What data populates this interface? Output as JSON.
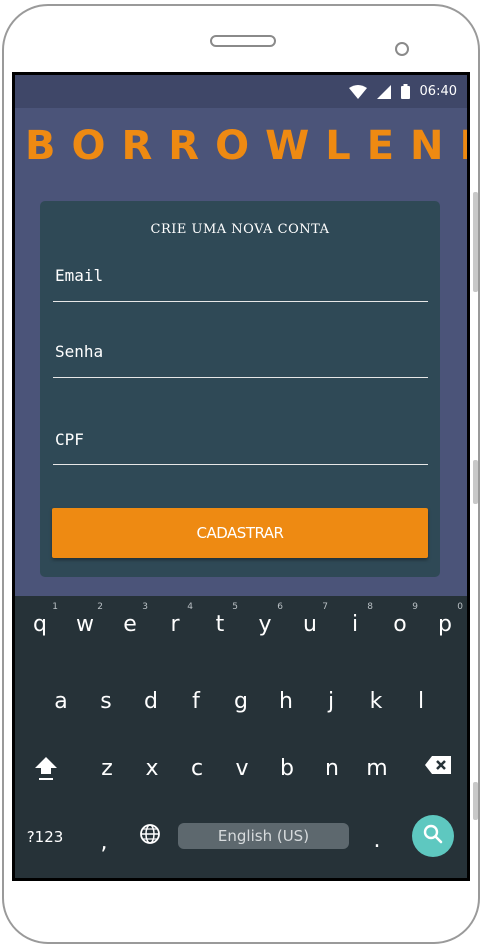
{
  "status_bar": {
    "time": "06:40"
  },
  "app": {
    "logo": "BORROWLEND",
    "form": {
      "title": "CRIE UMA NOVA CONTA",
      "email_label": "Email",
      "password_label": "Senha",
      "cpf_label": "CPF",
      "submit_label": "CADASTRAR"
    }
  },
  "keyboard": {
    "row1": [
      {
        "key": "q",
        "hint": "1"
      },
      {
        "key": "w",
        "hint": "2"
      },
      {
        "key": "e",
        "hint": "3"
      },
      {
        "key": "r",
        "hint": "4"
      },
      {
        "key": "t",
        "hint": "5"
      },
      {
        "key": "y",
        "hint": "6"
      },
      {
        "key": "u",
        "hint": "7"
      },
      {
        "key": "i",
        "hint": "8"
      },
      {
        "key": "o",
        "hint": "9"
      },
      {
        "key": "p",
        "hint": "0"
      }
    ],
    "row2": [
      "a",
      "s",
      "d",
      "f",
      "g",
      "h",
      "j",
      "k",
      "l"
    ],
    "row3": [
      "z",
      "x",
      "c",
      "v",
      "b",
      "n",
      "m"
    ],
    "symbols_label": "?123",
    "comma_label": ",",
    "period_label": ".",
    "space_label": "English (US)"
  },
  "colors": {
    "accent": "#ee8a12",
    "screen_bg": "#4b5479",
    "card_bg": "#2f4956",
    "keyboard_bg": "#263238",
    "search_button": "#5ec8c0"
  },
  "icons": [
    "wifi-icon",
    "signal-icon",
    "battery-icon",
    "shift-icon",
    "backspace-icon",
    "globe-icon",
    "search-icon"
  ]
}
